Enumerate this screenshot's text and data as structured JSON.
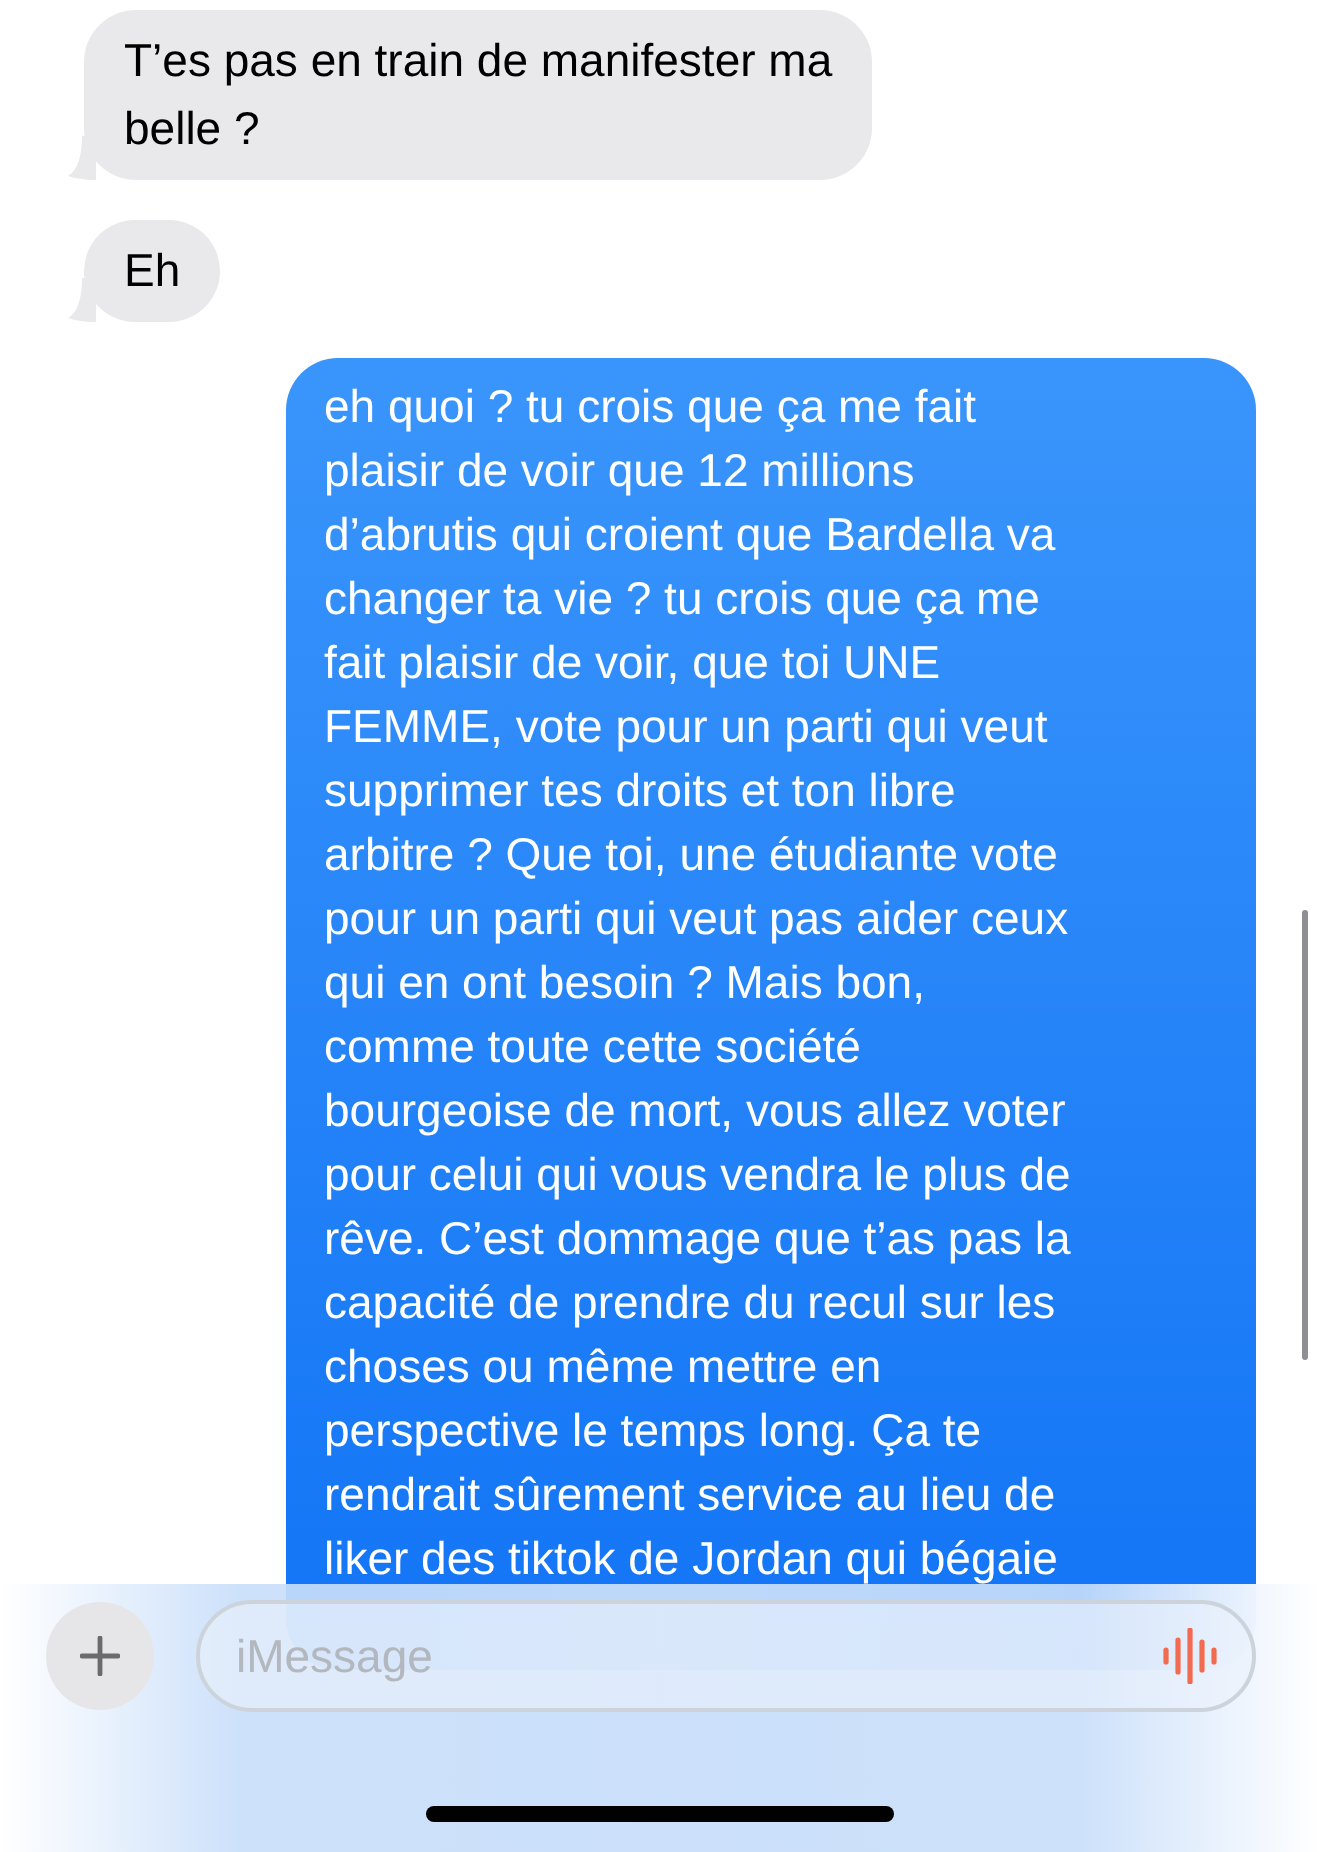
{
  "messages": [
    {
      "kind": "received",
      "text": "T’es pas en train de manifester ma\nbelle ?"
    },
    {
      "kind": "received",
      "text": "Eh"
    },
    {
      "kind": "sent",
      "text": "eh quoi ? tu crois que ça me fait\nplaisir de voir que 12 millions\nd’abrutis qui croient que Bardella va\nchanger ta vie ? tu crois que ça me\nfait plaisir de voir, que toi UNE\nFEMME, vote pour un parti qui veut\nsupprimer tes droits et ton libre\narbitre ? Que toi, une étudiante vote\npour un parti qui veut pas aider ceux\nqui en ont besoin ? Mais bon,\ncomme toute cette société\nbourgeoise de mort, vous allez voter\npour celui qui vous vendra le plus de\nrêve. C’est dommage que t’as pas la\ncapacité de prendre du recul sur les\nchoses ou même mettre en\nperspective le temps long. Ça te\nrendrait sûrement service au lieu de\nliker des tiktok de Jordan qui bégaie"
    }
  ],
  "composer": {
    "placeholder": "iMessage"
  }
}
